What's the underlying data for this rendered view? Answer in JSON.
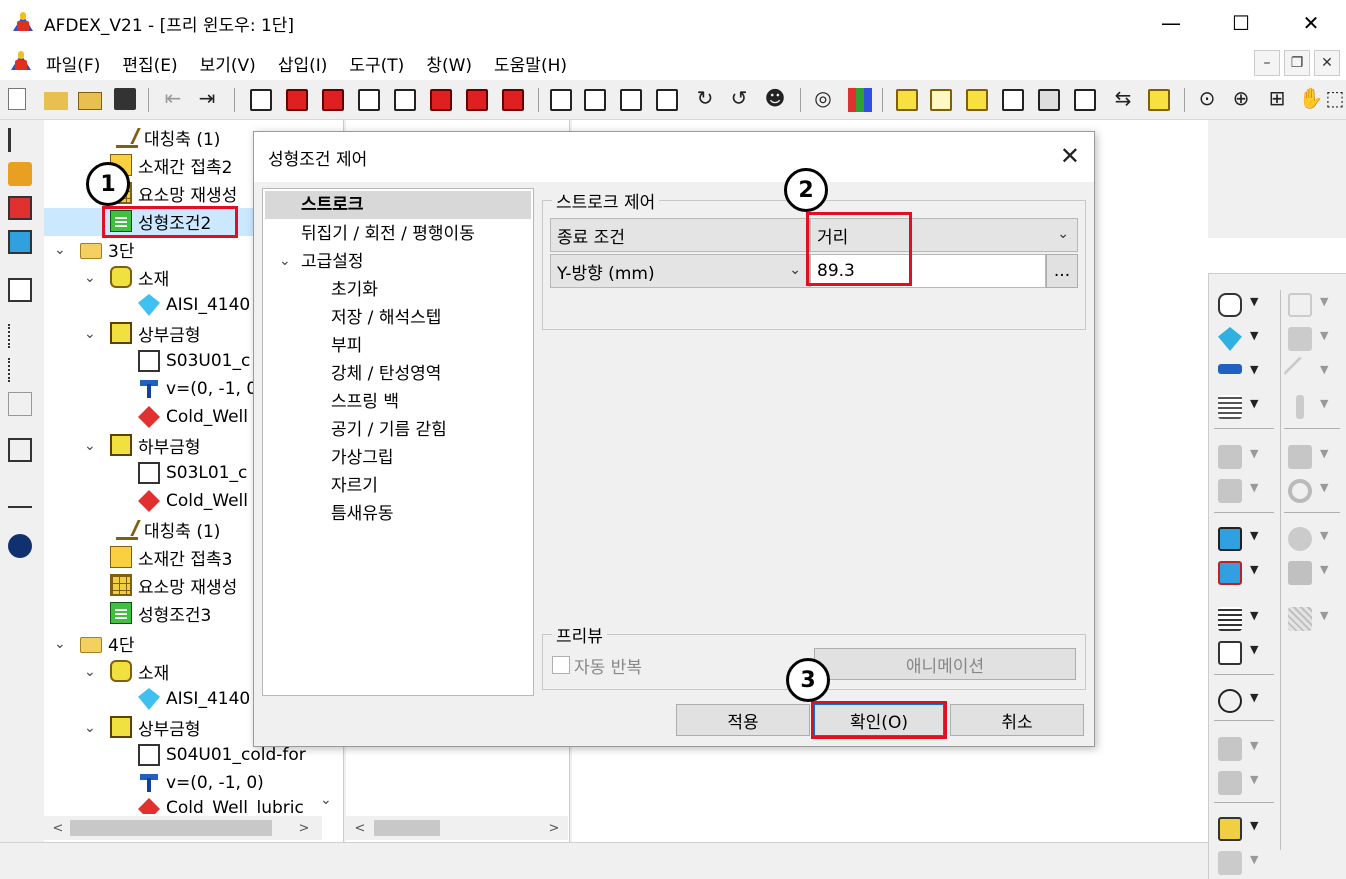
{
  "window": {
    "title": "AFDEX_V21 - [프리 윈도우: 1단]",
    "minimize": "—",
    "maximize": "☐",
    "close": "✕"
  },
  "menu": {
    "items": [
      "파일(F)",
      "편집(E)",
      "보기(V)",
      "삽입(I)",
      "도구(T)",
      "창(W)",
      "도움말(H)"
    ],
    "mdi_min": "–",
    "mdi_restore": "❐",
    "mdi_close": "✕"
  },
  "tree": {
    "rows": [
      {
        "label": "대칭축 (1)",
        "icon": "symmetry-axis-icon"
      },
      {
        "label": "소재간 접촉2",
        "icon": "contact-icon"
      },
      {
        "label": "요소망 재생성",
        "icon": "mesh-regen-icon"
      },
      {
        "label": "성형조건2",
        "icon": "forming-condition-icon"
      },
      {
        "label": "3단",
        "icon": "folder-icon"
      },
      {
        "label": "소재",
        "icon": "material-icon"
      },
      {
        "label": "AISI_4140",
        "icon": "gem-icon"
      },
      {
        "label": "상부금형",
        "icon": "upper-die-icon"
      },
      {
        "label": "S03U01_c",
        "icon": "die-part-icon"
      },
      {
        "label": "v=(0, -1, 0",
        "icon": "hammer-icon"
      },
      {
        "label": "Cold_Well",
        "icon": "lubricant-icon"
      },
      {
        "label": "하부금형",
        "icon": "lower-die-icon"
      },
      {
        "label": "S03L01_c",
        "icon": "die-part-icon"
      },
      {
        "label": "Cold_Well",
        "icon": "lubricant-icon"
      },
      {
        "label": "대칭축 (1)",
        "icon": "symmetry-axis-icon"
      },
      {
        "label": "소재간 접촉3",
        "icon": "contact-icon"
      },
      {
        "label": "요소망 재생성",
        "icon": "mesh-regen-icon"
      },
      {
        "label": "성형조건3",
        "icon": "forming-condition-icon"
      },
      {
        "label": "4단",
        "icon": "folder-icon"
      },
      {
        "label": "소재",
        "icon": "material-icon"
      },
      {
        "label": "AISI_4140",
        "icon": "gem-icon"
      },
      {
        "label": "상부금형",
        "icon": "upper-die-icon"
      },
      {
        "label": "S04U01_cold-for",
        "icon": "die-part-icon"
      },
      {
        "label": "v=(0, -1, 0)",
        "icon": "hammer-icon"
      },
      {
        "label": "Cold_Well_lubric",
        "icon": "lubricant-icon"
      }
    ]
  },
  "annotations": {
    "step1": "1",
    "step2": "2",
    "step3": "3"
  },
  "dialog": {
    "title": "성형조건 제어",
    "nav": {
      "stroke": "스트로크",
      "flip": "뒤집기 / 회전 / 평행이동",
      "advanced": "고급설정",
      "sub": [
        "초기화",
        "저장 / 해석스텝",
        "부피",
        "강체 / 탄성영역",
        "스프링 백",
        "공기 / 기름 갇힘",
        "가상그립",
        "자르기",
        "틈새유동"
      ]
    },
    "stroke_group": {
      "label": "스트로크 제어",
      "end_condition_label": "종료 조건",
      "end_condition_value": "거리",
      "direction_value": "Y-방향 (mm)",
      "distance_value": "89.3",
      "ellipsis": "..."
    },
    "preview_group": {
      "label": "프리뷰",
      "auto_repeat": "자동 반복",
      "animation": "애니메이션"
    },
    "buttons": {
      "apply": "적용",
      "ok": "확인(O)",
      "cancel": "취소"
    }
  }
}
